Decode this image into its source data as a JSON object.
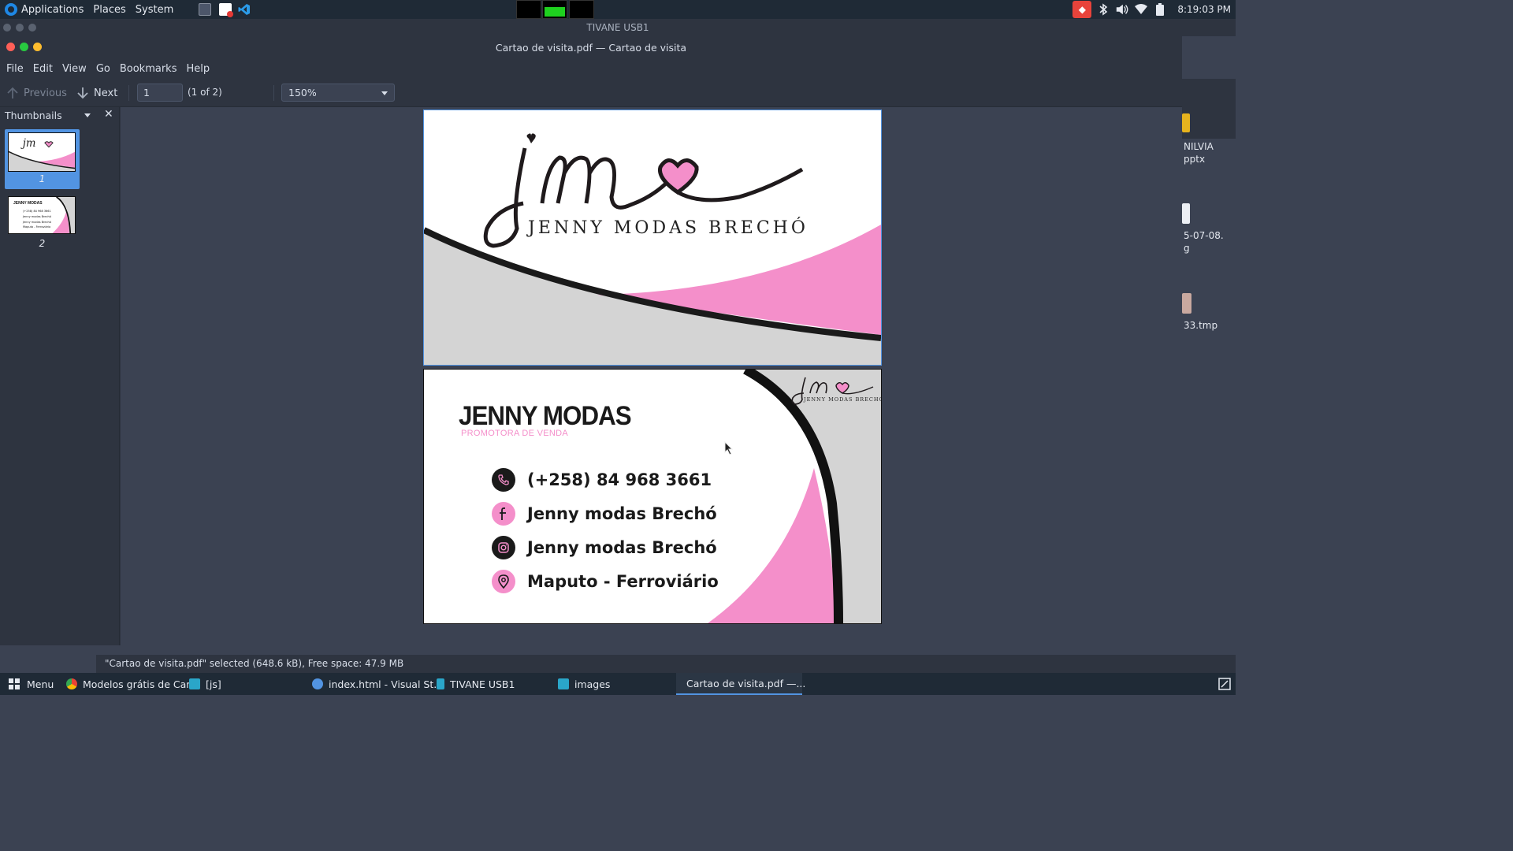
{
  "top_panel": {
    "applications_label": "Applications",
    "places_label": "Places",
    "system_label": "System",
    "clock": "8:19:03 PM"
  },
  "background_window": {
    "title": "TIVANE USB1"
  },
  "desktop": {
    "items": [
      {
        "label_line1": "NILVIA",
        "label_line2": "pptx"
      },
      {
        "label_line1": "5-07-08.",
        "label_line2": "g"
      },
      {
        "label_line1": "33.tmp",
        "label_line2": ""
      }
    ]
  },
  "window": {
    "title": "Cartao de visita.pdf — Cartao de visita",
    "menu": [
      "File",
      "Edit",
      "View",
      "Go",
      "Bookmarks",
      "Help"
    ],
    "toolbar": {
      "previous_label": "Previous",
      "next_label": "Next",
      "page_value": "1",
      "page_count": "(1 of 2)",
      "zoom": "150%"
    },
    "sidebar": {
      "title": "Thumbnails",
      "thumbnails": [
        {
          "number": "1",
          "selected": true
        },
        {
          "number": "2",
          "selected": false
        }
      ]
    }
  },
  "card_front": {
    "monogram": "jm",
    "brand": "JENNY MODAS BRECHÓ"
  },
  "card_back": {
    "monogram": "jm",
    "brand": "JENNY MODAS BRECHÓ",
    "title": "JENNY MODAS",
    "subtitle": "PROMOTORA DE VENDA",
    "contacts": [
      {
        "icon": "phone-icon",
        "text": "(+258) 84 968 3661"
      },
      {
        "icon": "facebook-icon",
        "text": "Jenny modas Brechó"
      },
      {
        "icon": "instagram-icon",
        "text": "Jenny modas Brechó"
      },
      {
        "icon": "location-pin-icon",
        "text": "Maputo - Ferroviário"
      }
    ]
  },
  "thumb2_lines": {
    "title": "JENNY MODAS",
    "l1": "(+258) 84 968 3661",
    "l2": "Jenny modas Brechó",
    "l3": "Jenny modas Brechó",
    "l4": "Maputo - Ferroviário"
  },
  "status": {
    "text": "\"Cartao de visita.pdf\" selected (648.6 kB), Free space: 47.9 MB"
  },
  "taskbar": {
    "menu_label": "Menu",
    "tasks": [
      {
        "label": "Modelos grátis de Car..."
      },
      {
        "label": "[js]"
      },
      {
        "label": "index.html - Visual St..."
      },
      {
        "label": "TIVANE USB1"
      },
      {
        "label": "images"
      },
      {
        "label": "Cartao de visita.pdf —..."
      }
    ]
  },
  "colors": {
    "accent": "#5294e2",
    "pink": "#f48fca",
    "panel": "#1f2a36",
    "window": "#2e3440"
  }
}
